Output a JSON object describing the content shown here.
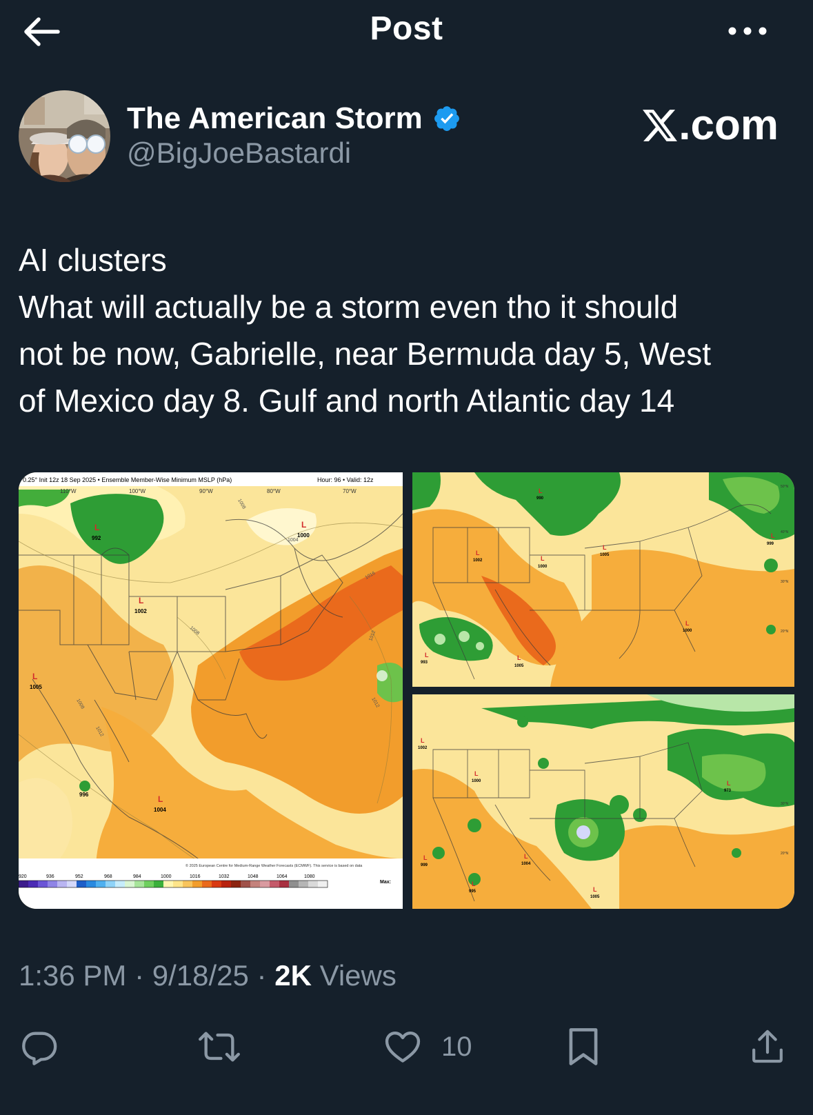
{
  "header": {
    "title": "Post",
    "back_icon": "arrow-left-icon",
    "more_icon": "more-horizontal-icon"
  },
  "author": {
    "name": "The American Storm",
    "handle": "@BigJoeBastardi",
    "verified_icon": "verified-badge-icon",
    "verified_color": "#1d9bf0"
  },
  "brand": {
    "x_logo": "x-logo-icon",
    "text": ".com"
  },
  "post": {
    "lines": [
      "AI clusters",
      "What will actually be a storm even tho it should",
      "not be now, Gabrielle, near Bermuda day 5, West",
      "of Mexico day 8. Gulf  and north Atlantic day 14"
    ]
  },
  "map_main": {
    "header_left": "0.25° Init 12z 18 Sep 2025 • Ensemble Member-Wise Minimum MSLP (hPa)",
    "header_hour": "Hour: 96 • Valid: 12z",
    "lon_labels": [
      "110°W",
      "100°W",
      "90°W",
      "80°W",
      "70°W"
    ],
    "lows": [
      {
        "label": "L",
        "value": "992"
      },
      {
        "label": "L",
        "value": "1000"
      },
      {
        "label": "L",
        "value": "1002"
      },
      {
        "label": "L",
        "value": "1005"
      },
      {
        "label": "L",
        "value": "996"
      },
      {
        "label": "L",
        "value": "1004"
      }
    ],
    "isobars": [
      "1008",
      "1004",
      "1008",
      "1012",
      "1008",
      "1012",
      "1012",
      "1016"
    ],
    "copyright": "© 2025 European Centre for Medium-Range Weather Forecasts (ECMWF). This service is based on data",
    "scale_ticks": [
      "920",
      "936",
      "952",
      "968",
      "984",
      "1000",
      "1016",
      "1032",
      "1048",
      "1064",
      "1080"
    ],
    "max_label": "Max:"
  },
  "map_top_right": {
    "lows": [
      {
        "label": "L",
        "value": "990"
      },
      {
        "label": "L",
        "value": "1002"
      },
      {
        "label": "L",
        "value": "1000"
      },
      {
        "label": "L",
        "value": "1005"
      },
      {
        "label": "L",
        "value": "1000"
      },
      {
        "label": "L",
        "value": "993"
      },
      {
        "label": "L",
        "value": "1005"
      },
      {
        "label": "L",
        "value": "999"
      }
    ],
    "lat_labels": [
      "50°N",
      "40°N",
      "30°N",
      "20°N"
    ]
  },
  "map_bottom_right": {
    "lows": [
      {
        "label": "L",
        "value": "1002"
      },
      {
        "label": "L",
        "value": "1000"
      },
      {
        "label": "L",
        "value": "1004"
      },
      {
        "label": "L",
        "value": "1005"
      },
      {
        "label": "L",
        "value": "999"
      },
      {
        "label": "L",
        "value": "995"
      },
      {
        "label": "L",
        "value": "973"
      }
    ],
    "lat_labels": [
      "30°N",
      "20°N"
    ]
  },
  "meta": {
    "time": "1:36 PM",
    "sep1": " · ",
    "date": "9/18/25",
    "sep2": " · ",
    "views_count": "2K",
    "views_label": " Views"
  },
  "actions": {
    "reply_icon": "reply-icon",
    "repost_icon": "repost-icon",
    "like_icon": "heart-icon",
    "like_count": "10",
    "bookmark_icon": "bookmark-icon",
    "share_icon": "share-icon"
  },
  "colors": {
    "background": "#15202b",
    "text_secondary": "#8b98a5",
    "accent": "#1d9bf0"
  }
}
